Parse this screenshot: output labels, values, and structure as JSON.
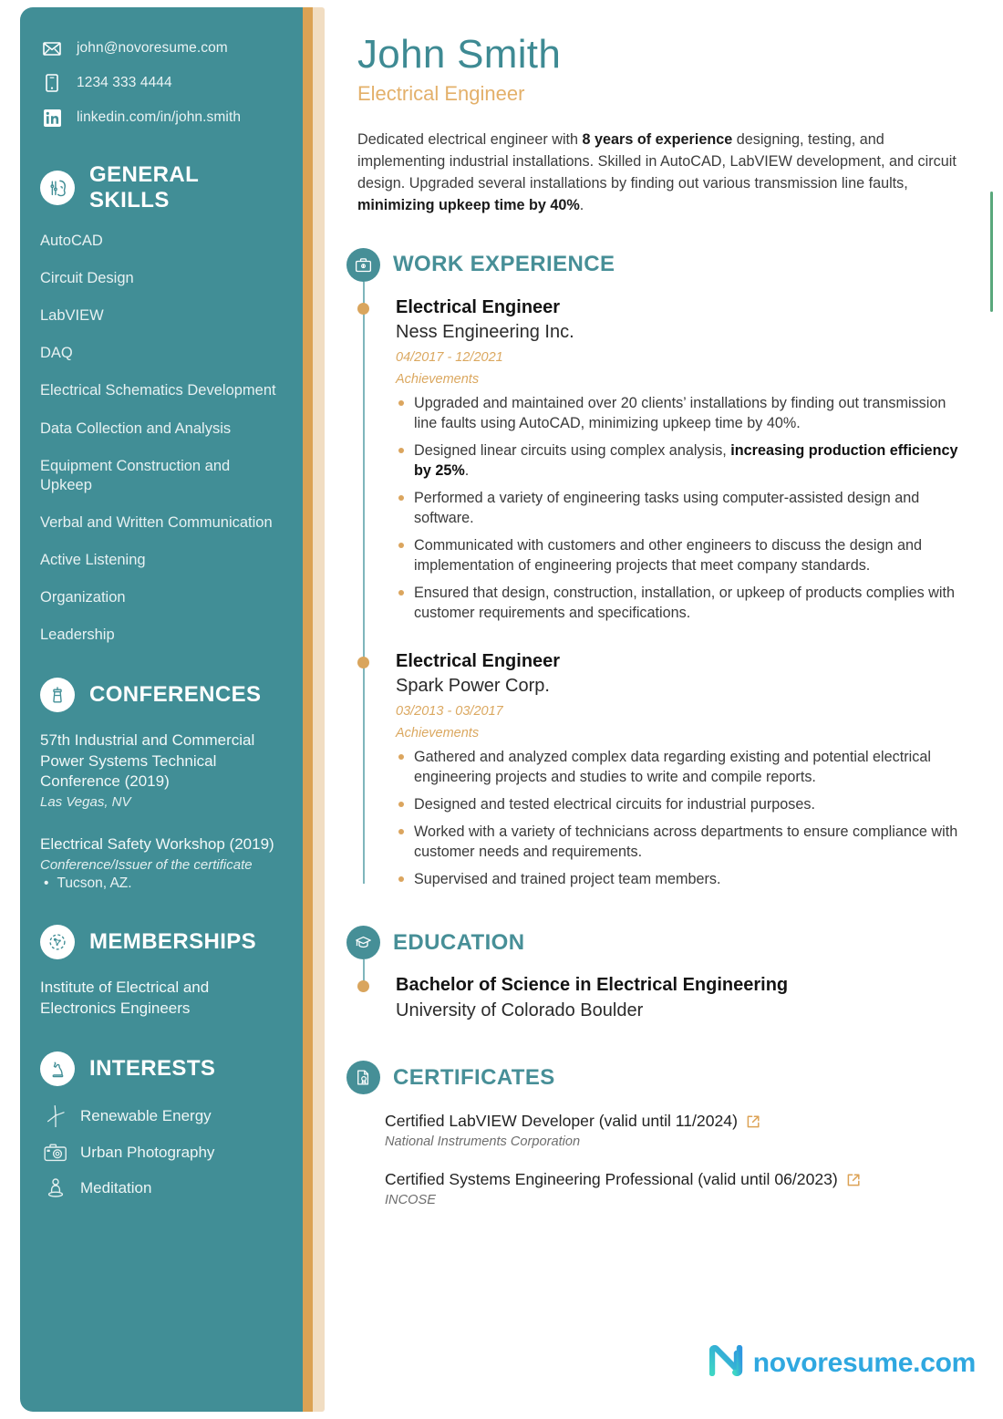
{
  "colors": {
    "teal": "#418E96",
    "teal_text": "#478F97",
    "gold": "#DBA254",
    "cream": "#F1DDC2",
    "accent_gold_text": "#DBA860",
    "green_rule": "#5AA87C",
    "logo_blue": "#2FA8E0"
  },
  "sidebar": {
    "contacts": [
      {
        "icon": "envelope-icon",
        "text": "john@novoresume.com"
      },
      {
        "icon": "phone-icon",
        "text": "1234 333 4444"
      },
      {
        "icon": "linkedin-icon",
        "text": "linkedin.com/in/john.smith"
      }
    ],
    "general_skills": {
      "icon": "skills-head-icon",
      "title": "GENERAL SKILLS",
      "items": [
        "AutoCAD",
        "Circuit Design",
        "LabVIEW",
        "DAQ",
        "Electrical Schematics Development",
        "Data Collection and Analysis",
        "Equipment Construction and Upkeep",
        "Verbal and Written Communication",
        "Active Listening",
        "Organization",
        "Leadership"
      ]
    },
    "conferences": {
      "icon": "podium-icon",
      "title": "CONFERENCES",
      "items": [
        {
          "title": "57th Industrial and Commercial Power Systems Technical Conference (2019)",
          "sub": "Las Vegas, NV",
          "bullet": null
        },
        {
          "title": "Electrical Safety Workshop (2019)",
          "sub": "Conference/Issuer of the certificate",
          "bullet": "Tucson, AZ."
        }
      ]
    },
    "memberships": {
      "icon": "network-icon",
      "title": "MEMBERSHIPS",
      "items": [
        "Institute of Electrical and Electronics Engineers"
      ]
    },
    "interests": {
      "icon": "chess-knight-icon",
      "title": "INTERESTS",
      "items": [
        {
          "icon": "wind-turbine-icon",
          "label": "Renewable Energy"
        },
        {
          "icon": "camera-icon",
          "label": "Urban Photography"
        },
        {
          "icon": "meditation-icon",
          "label": "Meditation"
        }
      ]
    }
  },
  "header": {
    "name": "John Smith",
    "role": "Electrical Engineer",
    "summary_parts": [
      {
        "text": "Dedicated electrical engineer with ",
        "bold": false
      },
      {
        "text": "8 years of experience",
        "bold": true
      },
      {
        "text": " designing, testing, and implementing industrial installations. Skilled in AutoCAD, LabVIEW development, and circuit design. Upgraded several installations by finding out various transmission line faults, ",
        "bold": false
      },
      {
        "text": "minimizing upkeep time by 40%",
        "bold": true
      },
      {
        "text": ".",
        "bold": false
      }
    ]
  },
  "work": {
    "icon": "briefcase-icon",
    "title": "WORK EXPERIENCE",
    "entries": [
      {
        "title": "Electrical Engineer",
        "org": "Ness Engineering Inc.",
        "dates": "04/2017 - 12/2021",
        "achievements_label": "Achievements",
        "achievements": [
          [
            {
              "text": "Upgraded and maintained over 20 clients’ installations by finding out transmission line faults using AutoCAD, minimizing upkeep time by 40%.",
              "bold": false
            }
          ],
          [
            {
              "text": "Designed linear circuits using complex analysis, ",
              "bold": false
            },
            {
              "text": "increasing production efficiency by 25%",
              "bold": true
            },
            {
              "text": ".",
              "bold": false
            }
          ],
          [
            {
              "text": "Performed a variety of engineering tasks using computer-assisted design and software.",
              "bold": false
            }
          ],
          [
            {
              "text": "Communicated with customers and other engineers to discuss the design and implementation of engineering projects that meet company standards.",
              "bold": false
            }
          ],
          [
            {
              "text": "Ensured that design, construction, installation, or upkeep of products complies with customer requirements and specifications.",
              "bold": false
            }
          ]
        ]
      },
      {
        "title": "Electrical Engineer",
        "org": "Spark Power Corp.",
        "dates": "03/2013 - 03/2017",
        "achievements_label": "Achievements",
        "achievements": [
          [
            {
              "text": "Gathered and analyzed complex data regarding existing and potential electrical engineering projects and studies to write and compile reports.",
              "bold": false
            }
          ],
          [
            {
              "text": "Designed and tested electrical circuits for industrial purposes.",
              "bold": false
            }
          ],
          [
            {
              "text": "Worked with a variety of technicians across departments to ensure compliance with customer needs and requirements.",
              "bold": false
            }
          ],
          [
            {
              "text": "Supervised and trained project team members.",
              "bold": false
            }
          ]
        ]
      }
    ]
  },
  "education": {
    "icon": "graduation-cap-icon",
    "title": "EDUCATION",
    "entries": [
      {
        "degree": "Bachelor of Science in Electrical Engineering",
        "school": "University of Colorado Boulder"
      }
    ]
  },
  "certificates": {
    "icon": "certificate-icon",
    "title": "CERTIFICATES",
    "entries": [
      {
        "name": "Certified LabVIEW Developer (valid until 11/2024)",
        "issuer": "National Instruments Corporation",
        "link_icon": "external-link-icon"
      },
      {
        "name": "Certified Systems Engineering Professional (valid until 06/2023)",
        "issuer": "INCOSE",
        "link_icon": "external-link-icon"
      }
    ]
  },
  "footer": {
    "logo_icon": "novoresume-logo-icon",
    "logo_text": "novoresume.com"
  }
}
